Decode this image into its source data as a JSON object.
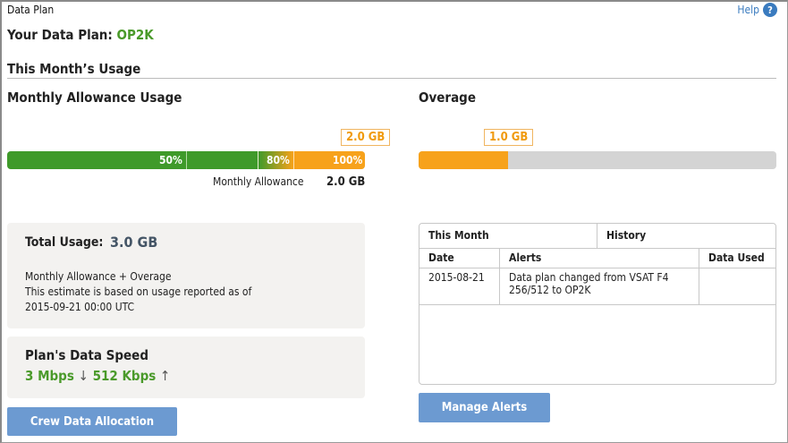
{
  "window": {
    "title": "Data Plan",
    "help_label": "Help",
    "help_icon": "question-circle-icon"
  },
  "plan": {
    "prefix": "Your Data Plan:",
    "name": "OP2K"
  },
  "usage_section": {
    "title": "This Month’s Usage"
  },
  "allowance": {
    "title": "Monthly Allowance Usage",
    "callout": "2.0 GB",
    "markers": [
      "50%",
      "80%",
      "100%"
    ],
    "fill_fraction": 1.0,
    "label": "Monthly Allowance",
    "value": "2.0 GB"
  },
  "overage": {
    "title": "Overage",
    "callout": "1.0 GB",
    "fill_fraction": 0.25
  },
  "total": {
    "label": "Total Usage:",
    "value": "3.0 GB",
    "note1": "Monthly Allowance + Overage",
    "note2": "This estimate is based on usage reported as of",
    "note3": "2015-09-21 00:00 UTC"
  },
  "speed": {
    "title": "Plan's Data Speed",
    "down": "3 Mbps",
    "down_arrow": "↓",
    "up": "512 Kbps",
    "up_arrow": "↑"
  },
  "buttons": {
    "crew": "Crew Data Allocation",
    "manage_alerts": "Manage Alerts"
  },
  "alerts": {
    "tabs": [
      "This Month",
      "History"
    ],
    "columns": [
      "Date",
      "Alerts",
      "Data Used"
    ],
    "rows": [
      {
        "date": "2015-08-21",
        "alert_line1": "Data plan changed from VSAT F4",
        "alert_line2": "256/512 to OP2K",
        "data_used": ""
      }
    ]
  },
  "colors": {
    "green": "#4a9a2a",
    "orange": "#f7a21b",
    "gray_bar": "#d4d4d4",
    "button": "#6c9ad1",
    "link": "#3a7bbf"
  }
}
